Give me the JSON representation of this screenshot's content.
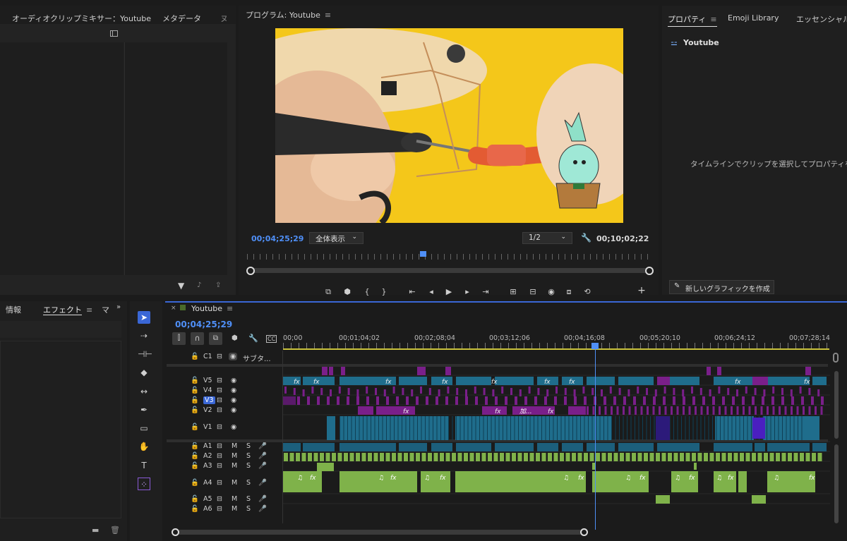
{
  "colors": {
    "accent": "#4f8ff7",
    "video_clip": "#1f6d8c",
    "pink_clip": "#7a1f8a",
    "audio_clip": "#7fb24a"
  },
  "top_left_panel": {
    "tabs": [
      {
        "label": "オーディオクリップミキサー：Youtube",
        "menu_icon": "hamburger-icon"
      },
      {
        "label": "メタデータ"
      },
      {
        "label": "ヌ"
      }
    ]
  },
  "program_monitor": {
    "title": "プログラム: Youtube",
    "timecode": "00;04;25;29",
    "zoom": "全体表示",
    "resolution": "1/2",
    "duration": "00;10;02;22",
    "playhead_fraction": 0.434,
    "image_alt": "はんだごてで電子回路を組み立てている写真"
  },
  "right_panel": {
    "tabs": [
      {
        "label": "プロパティ",
        "active": true
      },
      {
        "label": "Emoji Library"
      },
      {
        "label": "エッセンシャルグ"
      }
    ],
    "sequence_name": "Youtube",
    "empty_message": "タイムラインでクリップを選択してプロパティを表",
    "new_graphic_button": "新しいグラフィックを作成"
  },
  "effects_panel": {
    "tabs": [
      {
        "label": "情報"
      },
      {
        "label": "エフェクト",
        "active": true
      },
      {
        "label": "マ"
      }
    ]
  },
  "timeline": {
    "sequence_name": "Youtube",
    "timecode": "00;04;25;29",
    "ruler_labels": [
      "00;00",
      "00;01;04;02",
      "00;02;08;04",
      "00;03;12;06",
      "00;04;16;08",
      "00;05;20;10",
      "00;06;24;12",
      "00;07;28;14"
    ],
    "caption_track": {
      "name": "C1",
      "label": "サブタ..."
    },
    "video_tracks": [
      "V5",
      "V4",
      "V3",
      "V2",
      "V1"
    ],
    "audio_tracks": [
      "A1",
      "A2",
      "A3",
      "A4",
      "A5",
      "A6"
    ],
    "audio_mute": "M",
    "audio_solo": "S",
    "clip_labels": {
      "fx": "fx",
      "kanji": "加...",
      "music_note": "♫"
    }
  }
}
